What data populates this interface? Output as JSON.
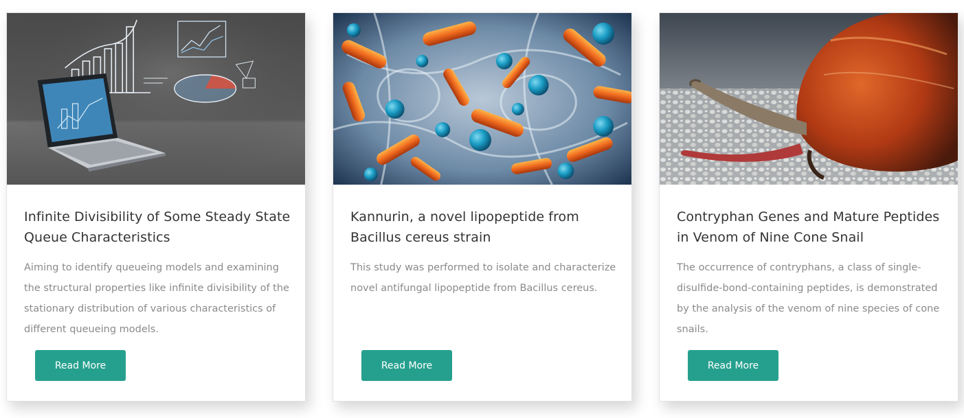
{
  "cards": [
    {
      "title": "Infinite Divisibility of Some Steady State Queue Characteristics",
      "description": "Aiming to identify queueing models and examining the structural properties like infinite divisibility of the stationary distribution of various characteristics of different queueing models.",
      "button_label": "Read More",
      "image_subject": "laptop with hand-drawn business charts on concrete wall"
    },
    {
      "title": "Kannurin, a novel lipopeptide from Bacillus cereus strain",
      "description": "This study was performed to isolate and characterize novel antifungal lipopeptide from Bacillus cereus.",
      "button_label": "Read More",
      "image_subject": "orange rod-shaped and blue spherical bacteria"
    },
    {
      "title": "Contryphan Genes and Mature Peptides in Venom of Nine Cone Snail",
      "description": "The occurrence of contryphans, a class of single-disulfide-bond-containing peptides, is demonstrated by the analysis of the venom of nine species of cone snails.",
      "button_label": "Read More",
      "image_subject": "cone snail extending its proboscis on gravel"
    }
  ],
  "colors": {
    "button": "#26a08e",
    "title": "#333333",
    "body_text": "#8a8a8a"
  }
}
